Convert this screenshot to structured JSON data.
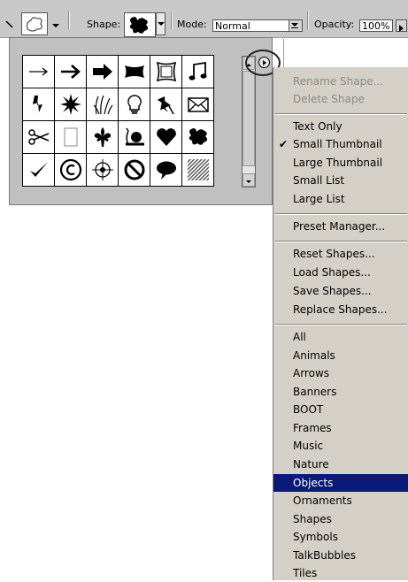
{
  "options_bar": {
    "shape_label": "Shape:",
    "mode_label": "Mode:",
    "mode_value": "Normal",
    "opacity_label": "Opacity:",
    "opacity_value": "100%"
  },
  "shape_grid": {
    "cells": [
      "arrow-thin-icon",
      "arrow-medium-icon",
      "arrow-bold-icon",
      "banner-icon",
      "frame-icon",
      "music-notes-icon",
      "lightning-icon",
      "starburst-icon",
      "grass-icon",
      "lightbulb-icon",
      "pushpin-icon",
      "envelope-icon",
      "scissors-icon",
      "blank-page-icon",
      "fleur-de-lis-icon",
      "snail-icon",
      "heart-icon",
      "puzzle-piece-icon",
      "checkmark-icon",
      "copyright-icon",
      "target-icon",
      "no-sign-icon",
      "speech-bubble-icon",
      "hatched-tile-icon"
    ]
  },
  "menu": {
    "items": [
      {
        "label": "Rename Shape...",
        "disabled": true
      },
      {
        "label": "Delete Shape",
        "disabled": true
      },
      {
        "label": "Text Only"
      },
      {
        "label": "Small Thumbnail",
        "checked": true
      },
      {
        "label": "Large Thumbnail"
      },
      {
        "label": "Small List"
      },
      {
        "label": "Large List"
      },
      {
        "label": "Preset Manager..."
      },
      {
        "label": "Reset Shapes..."
      },
      {
        "label": "Load Shapes..."
      },
      {
        "label": "Save Shapes..."
      },
      {
        "label": "Replace Shapes..."
      },
      {
        "label": "All"
      },
      {
        "label": "Animals"
      },
      {
        "label": "Arrows"
      },
      {
        "label": "Banners"
      },
      {
        "label": "BOOT"
      },
      {
        "label": "Frames"
      },
      {
        "label": "Music"
      },
      {
        "label": "Nature"
      },
      {
        "label": "Objects",
        "selected": true
      },
      {
        "label": "Ornaments"
      },
      {
        "label": "Shapes"
      },
      {
        "label": "Symbols"
      },
      {
        "label": "TalkBubbles"
      },
      {
        "label": "Tiles"
      }
    ],
    "check_glyph": "✔"
  },
  "colors": {
    "highlight": "#0a1a78",
    "menu_bg": "#d4d0c8",
    "panel_bg": "#c0c0c0"
  }
}
